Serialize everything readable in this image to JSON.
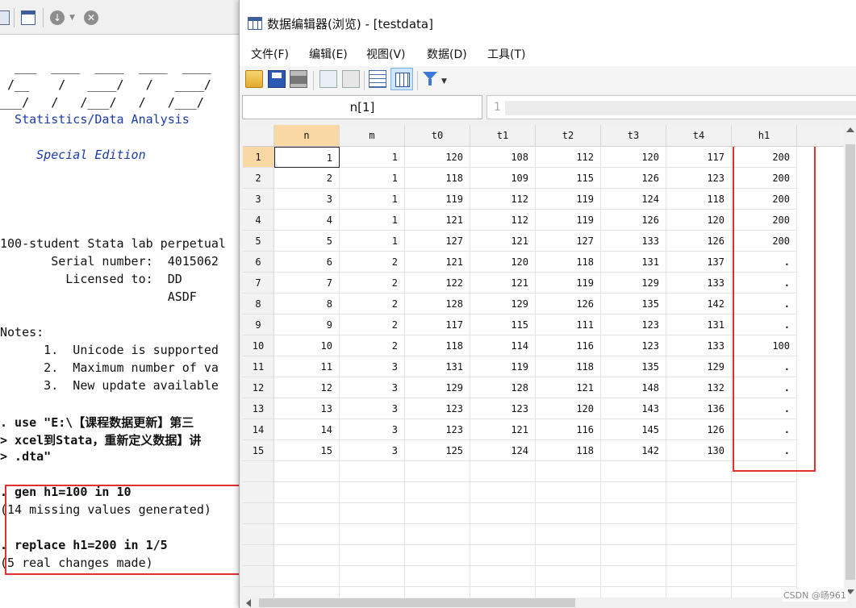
{
  "results": {
    "logo_lines": [
      "  ___  ____  ____  ____  ____",
      " /__    /   ____/   /   ____/",
      "___/   /   /___/   /   /___/"
    ],
    "subtitle": "  Statistics/Data Analysis",
    "edition": "     Special Edition",
    "license_line1": "100-student Stata lab perpetual",
    "serial_label": "       Serial number:  4015062",
    "licensed_label": "         Licensed to:  DD",
    "licensed_name": "                       ASDF",
    "notes_label": "Notes:",
    "notes": [
      "      1.  Unicode is supported",
      "      2.  Maximum number of va",
      "      3.  New update available"
    ],
    "use_cmd": [
      ". use \"E:\\【课程数据更新】第三",
      "> xcel到Stata，重新定义数据】讲",
      "> .dta\""
    ],
    "gen_cmd": ". gen h1=100 in 10",
    "gen_msg": "(14 missing values generated)",
    "replace_cmd": ". replace h1=200 in 1/5",
    "replace_msg": "(5 real changes made)"
  },
  "editor": {
    "title": "数据编辑器(浏览) - [testdata]",
    "menu": [
      "文件(F)",
      "编辑(E)",
      "视图(V)",
      "数据(D)",
      "工具(T)"
    ],
    "varname": "n[1]",
    "varvalue": "1"
  },
  "grid": {
    "columns": [
      "n",
      "m",
      "t0",
      "t1",
      "t2",
      "t3",
      "t4",
      "h1"
    ],
    "rows": [
      [
        "1",
        "1",
        "120",
        "108",
        "112",
        "120",
        "117",
        "200"
      ],
      [
        "2",
        "1",
        "118",
        "109",
        "115",
        "126",
        "123",
        "200"
      ],
      [
        "3",
        "1",
        "119",
        "112",
        "119",
        "124",
        "118",
        "200"
      ],
      [
        "4",
        "1",
        "121",
        "112",
        "119",
        "126",
        "120",
        "200"
      ],
      [
        "5",
        "1",
        "127",
        "121",
        "127",
        "133",
        "126",
        "200"
      ],
      [
        "6",
        "2",
        "121",
        "120",
        "118",
        "131",
        "137",
        "."
      ],
      [
        "7",
        "2",
        "122",
        "121",
        "119",
        "129",
        "133",
        "."
      ],
      [
        "8",
        "2",
        "128",
        "129",
        "126",
        "135",
        "142",
        "."
      ],
      [
        "9",
        "2",
        "117",
        "115",
        "111",
        "123",
        "131",
        "."
      ],
      [
        "10",
        "2",
        "118",
        "114",
        "116",
        "123",
        "133",
        "100"
      ],
      [
        "11",
        "3",
        "131",
        "119",
        "118",
        "135",
        "129",
        "."
      ],
      [
        "12",
        "3",
        "129",
        "128",
        "121",
        "148",
        "132",
        "."
      ],
      [
        "13",
        "3",
        "123",
        "123",
        "120",
        "143",
        "136",
        "."
      ],
      [
        "14",
        "3",
        "123",
        "121",
        "116",
        "145",
        "126",
        "."
      ],
      [
        "15",
        "3",
        "125",
        "124",
        "118",
        "142",
        "130",
        "."
      ]
    ]
  },
  "watermark": "CSDN @旸961",
  "colors": {
    "highlight_box": "#e03030",
    "active_header": "#f9d8a4",
    "text_blue": "#1a3aa8"
  },
  "icons": [
    "partial-window-icon",
    "table-icon",
    "down-arrow-circle-icon",
    "stop-icon",
    "open-folder-icon",
    "save-icon",
    "print-icon",
    "copy-icon",
    "paste-icon",
    "edit-mode-icon",
    "browse-mode-icon",
    "filter-icon"
  ]
}
